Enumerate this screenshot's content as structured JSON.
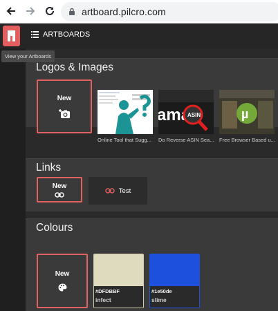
{
  "browser": {
    "url": "artboard.pilcro.com"
  },
  "app": {
    "nav_label": "ARTBOARDS",
    "tooltip": "View your Artboards"
  },
  "sections": {
    "logos": {
      "title": "Logos & Images",
      "new_label": "New",
      "items": [
        {
          "caption": "Online Tool that Sugg..."
        },
        {
          "caption": "Do Reverse ASIN Sea..."
        },
        {
          "caption": "Free Browser Based u..."
        }
      ]
    },
    "links": {
      "title": "Links",
      "new_label": "New",
      "items": [
        {
          "label": "Test"
        }
      ]
    },
    "colours": {
      "title": "Colours",
      "new_label": "New",
      "items": [
        {
          "hex": "#DFDBBF",
          "name": "infect",
          "color": "#dfdbbf"
        },
        {
          "hex": "#1e50de",
          "name": "slime",
          "color": "#1e50de"
        }
      ]
    }
  },
  "theme": {
    "accent": "#e06262",
    "background": "#2a2a2a",
    "panel": "#3a3a3a"
  }
}
